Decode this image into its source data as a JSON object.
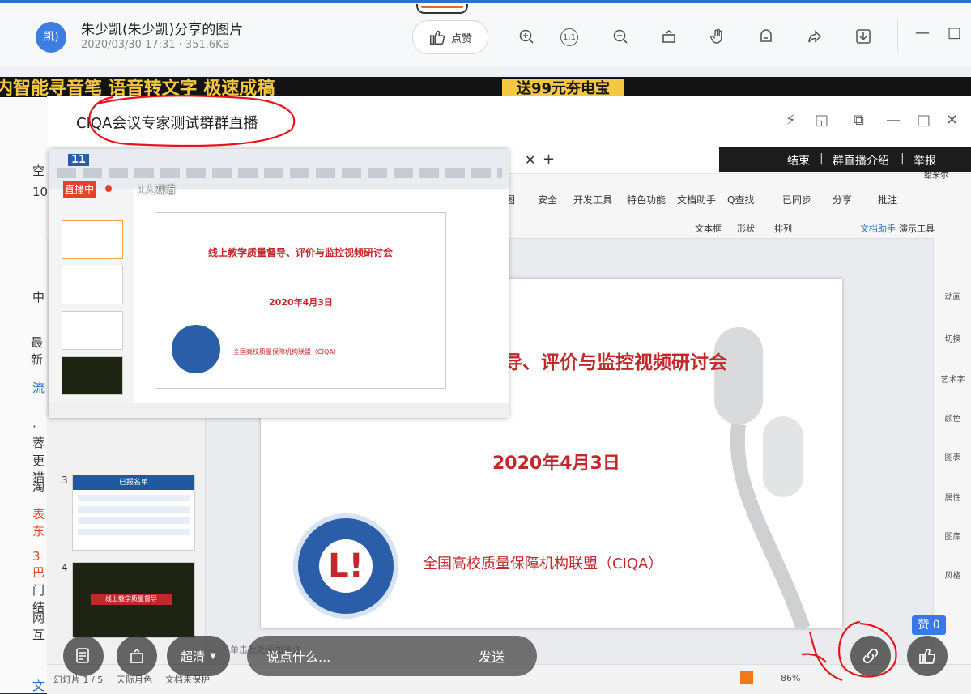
{
  "viewer": {
    "avatar_text": "凯)",
    "sender": "朱少凯(朱少凯)分享的图片",
    "meta": "2020/03/30 17:31 · 351.6KB",
    "like_label": "点赞",
    "toolbar_icons": [
      "zoom-in-icon",
      "actual-size-icon",
      "zoom-out-icon",
      "rotate-icon",
      "hand-icon",
      "screenshot-icon",
      "share-icon",
      "download-icon"
    ],
    "actual_size_text": "1:1",
    "window_controls": [
      "—",
      "□"
    ]
  },
  "background": {
    "banner_text": "内智能寻音笔 语音转文字 极速成稿",
    "banner_ad": "送99元夯电宝",
    "left_chars": [
      "空",
      "10",
      "中",
      "最新",
      "流",
      "·蓉",
      "更猫",
      "淘",
      "表东",
      "3巴",
      "门结",
      "网互",
      "文"
    ]
  },
  "live": {
    "title": "CIQA会议专家测试群群直播",
    "live_badge": "直播中",
    "viewers": "1人观看",
    "top_links": [
      "结束",
      "群直播介绍",
      "举报"
    ],
    "user_name": "蛤米尔",
    "menu_tabs": [
      "图",
      "安全",
      "开发工具",
      "特色功能",
      "文档助手",
      "Q查找"
    ],
    "ribbon_right": [
      "已同步",
      "分享",
      "批注"
    ],
    "ribbon_labels": [
      "文本框",
      "形状",
      "排列",
      "文档助手",
      "演示工具"
    ],
    "slide": {
      "title_partial": "导、评价与监控视频研讨会",
      "date": "2020年4月3日",
      "org": "全国高校质量保障机构联盟（CIQA）"
    },
    "mini_slide": {
      "title": "线上教学质量督导、评价与监控视频研讨会",
      "date": "2020年4月3日",
      "org": "全国高校质量保障机构联盟（CIQA）",
      "tab_text": "11"
    },
    "thumbs": [
      {
        "num": "3",
        "header": "已报名单"
      },
      {
        "num": "4",
        "header": "线上教学质量督导"
      }
    ],
    "right_panel": [
      "动画",
      "切换",
      "艺术字",
      "颜色",
      "图表",
      "属性",
      "图库",
      "风格"
    ],
    "status": {
      "slide_counter": "幻灯片 1 / 5",
      "theme": "天际月色",
      "protect": "文档未保护",
      "zoom": "86%",
      "notes": "单击此处添加备注"
    },
    "quality": "超清",
    "chat_placeholder": "说点什么...",
    "send": "发送",
    "zan_badge": "赞 0"
  }
}
